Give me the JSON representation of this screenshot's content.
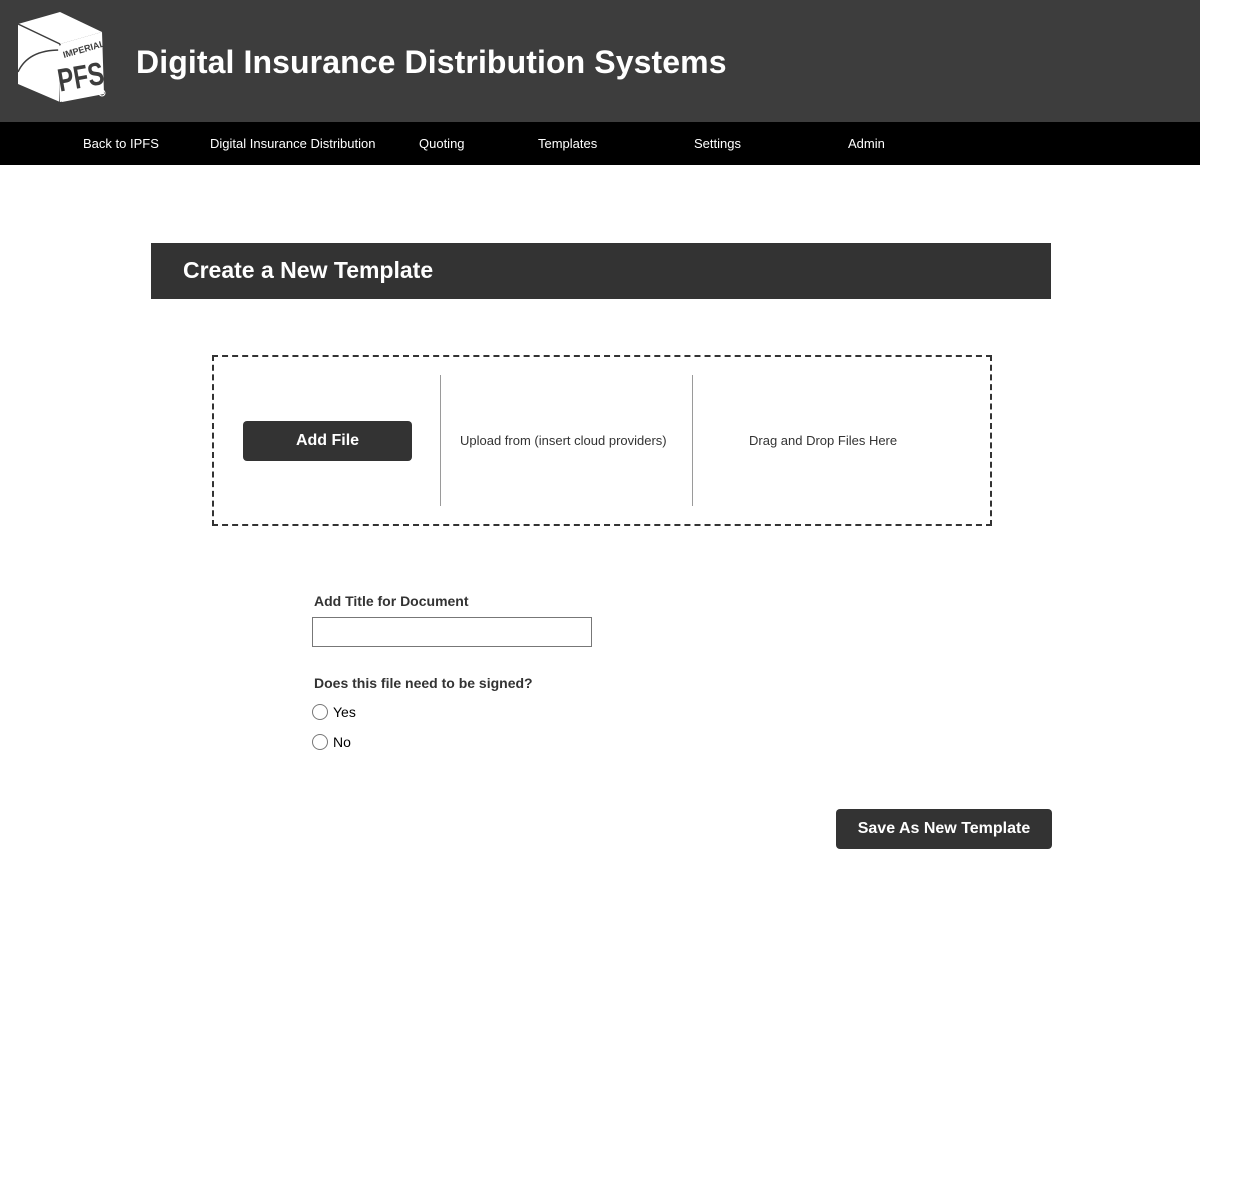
{
  "header": {
    "logo_icon": "imperial-pfs-cube-logo",
    "logo_text_top": "IMPERIAL",
    "logo_text_main": "PFS",
    "title": "Digital Insurance Distribution Systems"
  },
  "nav": {
    "items": [
      {
        "label": "Back to IPFS"
      },
      {
        "label": "Digital Insurance Distribution"
      },
      {
        "label": "Quoting"
      },
      {
        "label": "Templates"
      },
      {
        "label": "Settings"
      },
      {
        "label": "Admin"
      }
    ]
  },
  "page": {
    "title": "Create a New Template"
  },
  "upload": {
    "add_file_label": "Add File",
    "cloud_label": "Upload from (insert cloud providers)",
    "drop_label": "Drag and Drop Files Here"
  },
  "form": {
    "title_label": "Add Title for Document",
    "title_value": "",
    "title_placeholder": "",
    "signed_question": "Does this file need to be signed?",
    "options": [
      {
        "label": "Yes",
        "selected": false
      },
      {
        "label": "No",
        "selected": false
      }
    ]
  },
  "actions": {
    "save_label": "Save As New Template"
  },
  "colors": {
    "header_bg": "#3d3d3d",
    "nav_bg": "#000000",
    "accent_dark": "#333333"
  }
}
